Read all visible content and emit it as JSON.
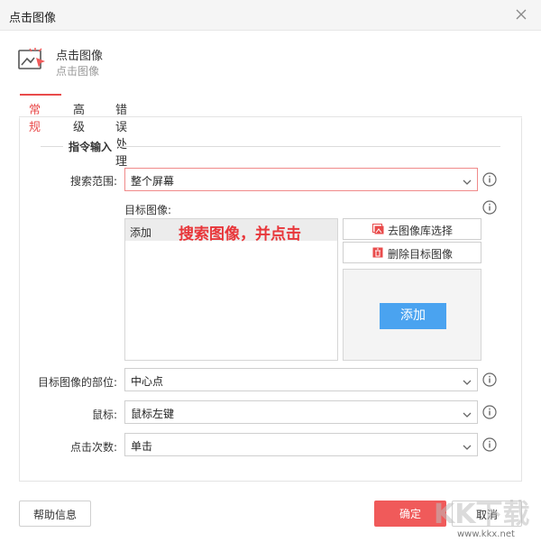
{
  "window": {
    "title": "点击图像"
  },
  "header": {
    "title": "点击图像",
    "subtitle": "点击图像",
    "icon": "cursor-image-icon"
  },
  "tabs": [
    {
      "label": "常规",
      "active": true
    },
    {
      "label": "高级",
      "active": false
    },
    {
      "label": "错误处理",
      "active": false
    }
  ],
  "section": {
    "title": "指令输入"
  },
  "fields": {
    "search_range": {
      "label": "搜索范围:",
      "value": "整个屏幕"
    },
    "target_image": {
      "label": "目标图像:",
      "list_item": "添加",
      "annotation": "搜索图像，并点击"
    },
    "image_part": {
      "label": "目标图像的部位:",
      "value": "中心点"
    },
    "mouse": {
      "label": "鼠标:",
      "value": "鼠标左键"
    },
    "click_count": {
      "label": "点击次数:",
      "value": "单击"
    }
  },
  "image_buttons": {
    "choose_library": "去图像库选择",
    "delete_target": "删除目标图像",
    "add": "添加"
  },
  "footer": {
    "help": "帮助信息",
    "ok": "确定",
    "cancel": "取消"
  },
  "watermark": {
    "text": "KK下载",
    "url": "www.kkx.net"
  },
  "colors": {
    "accent": "#f05a5a",
    "add_button": "#4aa3f0",
    "annotation": "#e8363a"
  }
}
